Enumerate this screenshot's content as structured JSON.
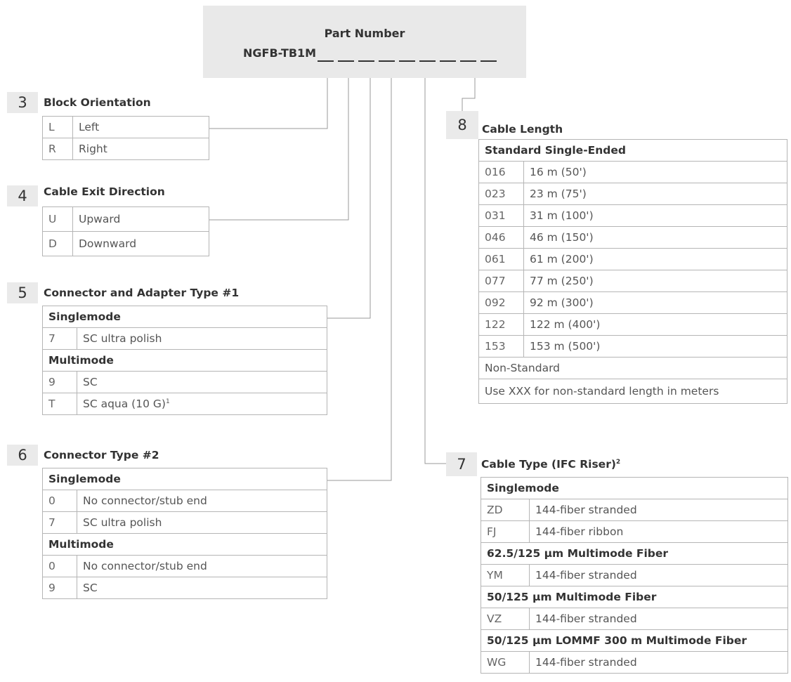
{
  "part_number": {
    "title": "Part Number",
    "prefix": "NGFB-TB1M"
  },
  "sections": {
    "s3": {
      "number": "3",
      "title": "Block Orientation",
      "rows": [
        {
          "code": "L",
          "label": "Left"
        },
        {
          "code": "R",
          "label": "Right"
        }
      ]
    },
    "s4": {
      "number": "4",
      "title": "Cable Exit Direction",
      "rows": [
        {
          "code": "U",
          "label": "Upward"
        },
        {
          "code": "D",
          "label": "Downward"
        }
      ]
    },
    "s5": {
      "number": "5",
      "title": "Connector and Adapter Type #1",
      "group_singlemode": "Singlemode",
      "sm_rows": [
        {
          "code": "7",
          "label": "SC ultra polish"
        }
      ],
      "group_multimode": "Multimode",
      "mm_rows": [
        {
          "code": "9",
          "label": "SC"
        },
        {
          "code": "T",
          "label": "SC aqua (10 G)",
          "sup": "1"
        }
      ]
    },
    "s6": {
      "number": "6",
      "title": "Connector Type #2",
      "group_singlemode": "Singlemode",
      "sm_rows": [
        {
          "code": "0",
          "label": "No connector/stub end"
        },
        {
          "code": "7",
          "label": "SC ultra polish"
        }
      ],
      "group_multimode": "Multimode",
      "mm_rows": [
        {
          "code": "0",
          "label": "No connector/stub end"
        },
        {
          "code": "9",
          "label": "SC"
        }
      ]
    },
    "s7": {
      "number": "7",
      "title": "Cable Type (IFC Riser)",
      "title_sup": "2",
      "group_singlemode": "Singlemode",
      "sm_rows": [
        {
          "code": "ZD",
          "label": "144-fiber stranded"
        },
        {
          "code": "FJ",
          "label": "144-fiber ribbon"
        }
      ],
      "group_625": "62.5/125 µm Multimode Fiber",
      "g625_rows": [
        {
          "code": "YM",
          "label": "144-fiber stranded"
        }
      ],
      "group_50": "50/125 µm Multimode Fiber",
      "g50_rows": [
        {
          "code": "VZ",
          "label": "144-fiber stranded"
        }
      ],
      "group_lommf": "50/125 µm LOMMF 300 m Multimode Fiber",
      "lommf_rows": [
        {
          "code": "WG",
          "label": "144-fiber stranded"
        }
      ]
    },
    "s8": {
      "number": "8",
      "title": "Cable Length",
      "group_standard": "Standard Single-Ended",
      "rows": [
        {
          "code": "016",
          "label": "16 m (50')"
        },
        {
          "code": "023",
          "label": "23 m (75')"
        },
        {
          "code": "031",
          "label": "31 m (100')"
        },
        {
          "code": "046",
          "label": "46 m (150')"
        },
        {
          "code": "061",
          "label": "61 m (200')"
        },
        {
          "code": "077",
          "label": "77 m (250')"
        },
        {
          "code": "092",
          "label": "92 m (300')"
        },
        {
          "code": "122",
          "label": "122 m (400')"
        },
        {
          "code": "153",
          "label": "153 m (500')"
        }
      ],
      "group_nonstandard": "Non-Standard",
      "nonstandard_note": "Use XXX for non-standard length in meters"
    }
  }
}
